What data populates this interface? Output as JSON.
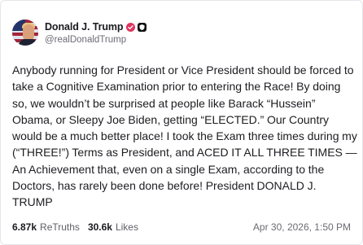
{
  "author": {
    "display_name": "Donald J. Trump",
    "handle": "@realDonaldTrump",
    "verified_badge_color": "#e0365f"
  },
  "post": {
    "text": "Anybody running for President or Vice President should be forced to take a Cognitive Examination prior to entering the Race! By doing so, we wouldn’t be surprised at people like Barack “Hussein” Obama, or Sleepy Joe Biden, getting “ELECTED.” Our Country would be a much better place! I took the Exam three times during my (“THREE!”) Terms as President, and ACED IT ALL THREE TIMES — An Achievement that, even on a single Exam, according to the Doctors, has rarely been done before! President DONALD J. TRUMP"
  },
  "stats": {
    "retruths_count": "6.87k",
    "retruths_label": "ReTruths",
    "likes_count": "30.6k",
    "likes_label": "Likes"
  },
  "timestamp": "Apr 30, 2026, 1:50 PM"
}
